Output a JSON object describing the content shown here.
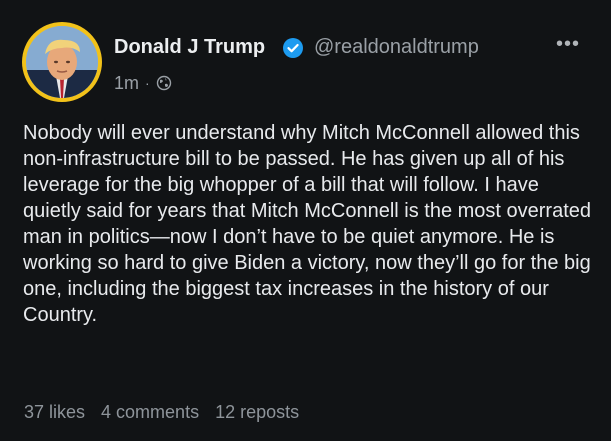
{
  "post": {
    "author": {
      "name": "Donald J Trump",
      "handle": "@realdonaldtrump",
      "verified": true,
      "avatar_ring_color": "#f2c21a"
    },
    "time": "1m",
    "separator": "·",
    "visibility_icon": "globe-icon",
    "more_icon": "more-horizontal-icon",
    "more_glyph": "•••",
    "text": "Nobody will ever understand why Mitch McConnell allowed this non-infrastructure bill to be passed. He has given up all of his leverage for the big whopper of a bill that will follow. I have quietly said for years that Mitch McConnell is the most overrated man in politics—now I don’t have to be quiet anymore. He is working so hard to give Biden a victory, now they’ll go for the big one, including the biggest tax increases in the history of our Country.",
    "stats": {
      "likes": "37 likes",
      "comments": "4 comments",
      "reposts": "12 reposts"
    }
  },
  "colors": {
    "background": "#111315",
    "text": "#e8eaed",
    "muted": "#9aa0a6",
    "verified_badge": "#1d9bf0"
  }
}
